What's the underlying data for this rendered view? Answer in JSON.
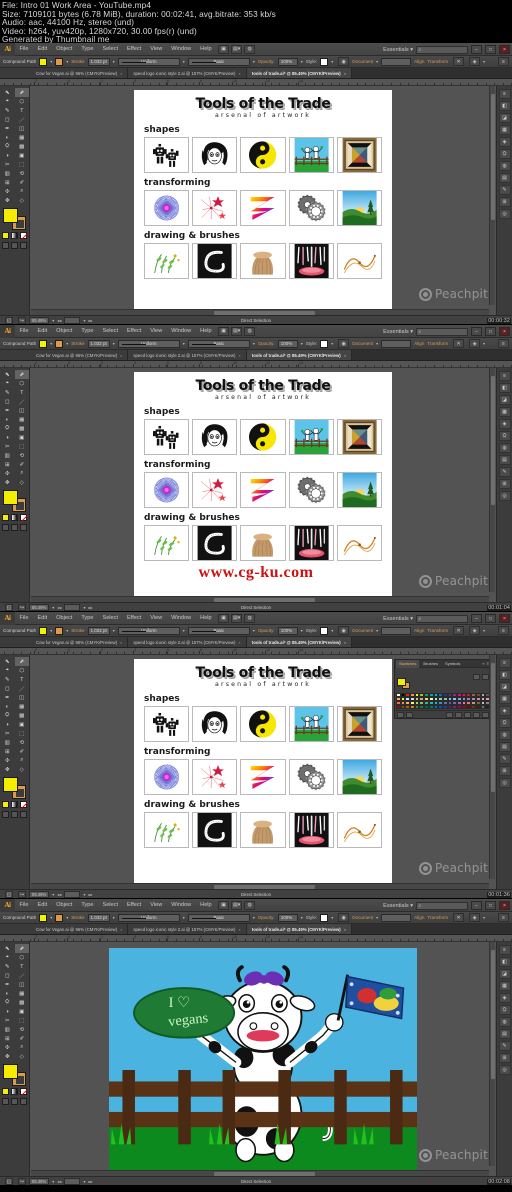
{
  "meta": {
    "line1": "File: Intro 01 Work Area - YouTube.mp4",
    "line2": "Size: 7109101 bytes (6.78 MiB), duration: 00:02:41, avg.bitrate: 353 kb/s",
    "line3": "Audio: aac, 44100 Hz, stereo (und)",
    "line4": "Video: h264, yuv420p, 1280x720, 30.00 fps(r) (und)",
    "line5": "Generated by Thumbnail me"
  },
  "app": {
    "logo": "Ai",
    "menus": [
      "File",
      "Edit",
      "Object",
      "Type",
      "Select",
      "Effect",
      "View",
      "Window",
      "Help"
    ],
    "workspace_label": "Essentials",
    "search_placeholder": "",
    "window_buttons": {
      "minimize": "–",
      "maximize": "□",
      "close": "×"
    }
  },
  "control_bar": {
    "selection_label": "Compound Path",
    "fill_label": "Fill",
    "stroke_label": "Stroke",
    "stroke_weight": "1.032 pt",
    "brush_profile": "Uniform",
    "stroke_style": "Basic",
    "opacity_label": "Opacity:",
    "opacity_value": "100%",
    "style_label": "Style:",
    "document_setup": "Document",
    "preferences_label": "Preferences",
    "align_label": "Align",
    "transform_label": "Transform",
    "fill_color": "#f3f300",
    "stroke_color": "#e09a46"
  },
  "tabs": [
    {
      "label": "Cow for Vegan.ai @ 96% (CMYK/Preview)",
      "active": false,
      "close": "×"
    },
    {
      "label": "speed logo iconic style 2.ai @ 157% (CMYK/Preview)",
      "active": false,
      "close": "×"
    },
    {
      "label": "tools of trade.ai* @ 85.49% (CMYK/Preview)",
      "active": true,
      "close": "×"
    }
  ],
  "ruler_numbers": [
    "2",
    "0",
    "2",
    "4",
    "6",
    "8",
    "10",
    "12",
    "14"
  ],
  "poster": {
    "title": "Tools of the Trade",
    "subtitle": "arsenal of artwork",
    "sections": [
      {
        "label": "shapes",
        "thumbs": [
          "robots",
          "girl-face",
          "yin-yang",
          "kids-fence",
          "quilt-pattern"
        ]
      },
      {
        "label": "transforming",
        "thumbs": [
          "spiral-mandala",
          "star-burst",
          "rainbow-zigzag",
          "gears",
          "sunset-landscape"
        ]
      },
      {
        "label": "drawing & brushes",
        "thumbs": [
          "leaf-sketch",
          "calligraphy",
          "hair-brush",
          "paint-strokes",
          "curve-lines"
        ]
      }
    ]
  },
  "status_bar": {
    "zoom": "85.49%",
    "page": "1",
    "tool": "Direct Selection"
  },
  "swatch_panel": {
    "tabs": [
      "Swatches",
      "Brushes",
      "Symbols"
    ],
    "swatch_rows": [
      [
        "#ffffff",
        "#000000",
        "#ed1c24",
        "#f7941e",
        "#fff200",
        "#8dc63f",
        "#00a651",
        "#00a99d",
        "#00aeef",
        "#0072bc",
        "#2e3192",
        "#662d91",
        "#92278f",
        "#ec008c",
        "#ed145b",
        "#be1e2d",
        "#996633",
        "#754c24",
        "#a7a9ac",
        "#58595b"
      ],
      [
        "#fbb040",
        "#f9ed32",
        "#c7eafb",
        "#bce4f6",
        "#a3d39c",
        "#f7977a",
        "#fdc68a",
        "#fff79a",
        "#c4df9b",
        "#a2d39c",
        "#82ca9c",
        "#7bcdc8",
        "#6ecff6",
        "#7da7d9",
        "#8493ca",
        "#8882be",
        "#a187be",
        "#bd8cbf",
        "#f49ac1",
        "#f5989d"
      ],
      [
        "#f26c4f",
        "#f68e56",
        "#fbaf5d",
        "#fff467",
        "#acd373",
        "#7cc576",
        "#3bb878",
        "#1abbb4",
        "#00bff3",
        "#438ccb",
        "#5574b9",
        "#605ca8",
        "#855fa8",
        "#a864a8",
        "#f06eaa",
        "#f26d7d",
        "#c69c6d",
        "#8c6239",
        "#bcbec0",
        "#808285"
      ],
      [
        "#9e0b0f",
        "#a0410d",
        "#a36209",
        "#ab9000",
        "#5e7c26",
        "#1c7b30",
        "#00693c",
        "#00746b",
        "#0076a3",
        "#0054a6",
        "#2b3990",
        "#54268d",
        "#70256d",
        "#9e005d",
        "#9e0039",
        "#790000",
        "#603813",
        "#42210b",
        "#6d6e71",
        "#231f20"
      ]
    ]
  },
  "cow_scene": {
    "sign_text_line1": "I ♡",
    "sign_text_line2": "vegans",
    "sky_color": "#4ab3e0",
    "grass_color": "#0c8a1e",
    "fence_color": "#5a3317"
  },
  "panels": [
    {
      "timestamp": "00:00:32",
      "watermark": "Peachpit",
      "has_cgku": false,
      "has_swatches": false,
      "content": "poster"
    },
    {
      "timestamp": "00:01:04",
      "watermark": "Peachpit",
      "has_cgku": true,
      "cgku_text": "www.cg-ku.com",
      "has_swatches": false,
      "content": "poster"
    },
    {
      "timestamp": "00:01:36",
      "watermark": "Peachpit",
      "has_cgku": false,
      "has_swatches": true,
      "content": "poster"
    },
    {
      "timestamp": "00:02:08",
      "watermark": "Peachpit",
      "has_cgku": false,
      "has_swatches": false,
      "content": "cow"
    }
  ]
}
